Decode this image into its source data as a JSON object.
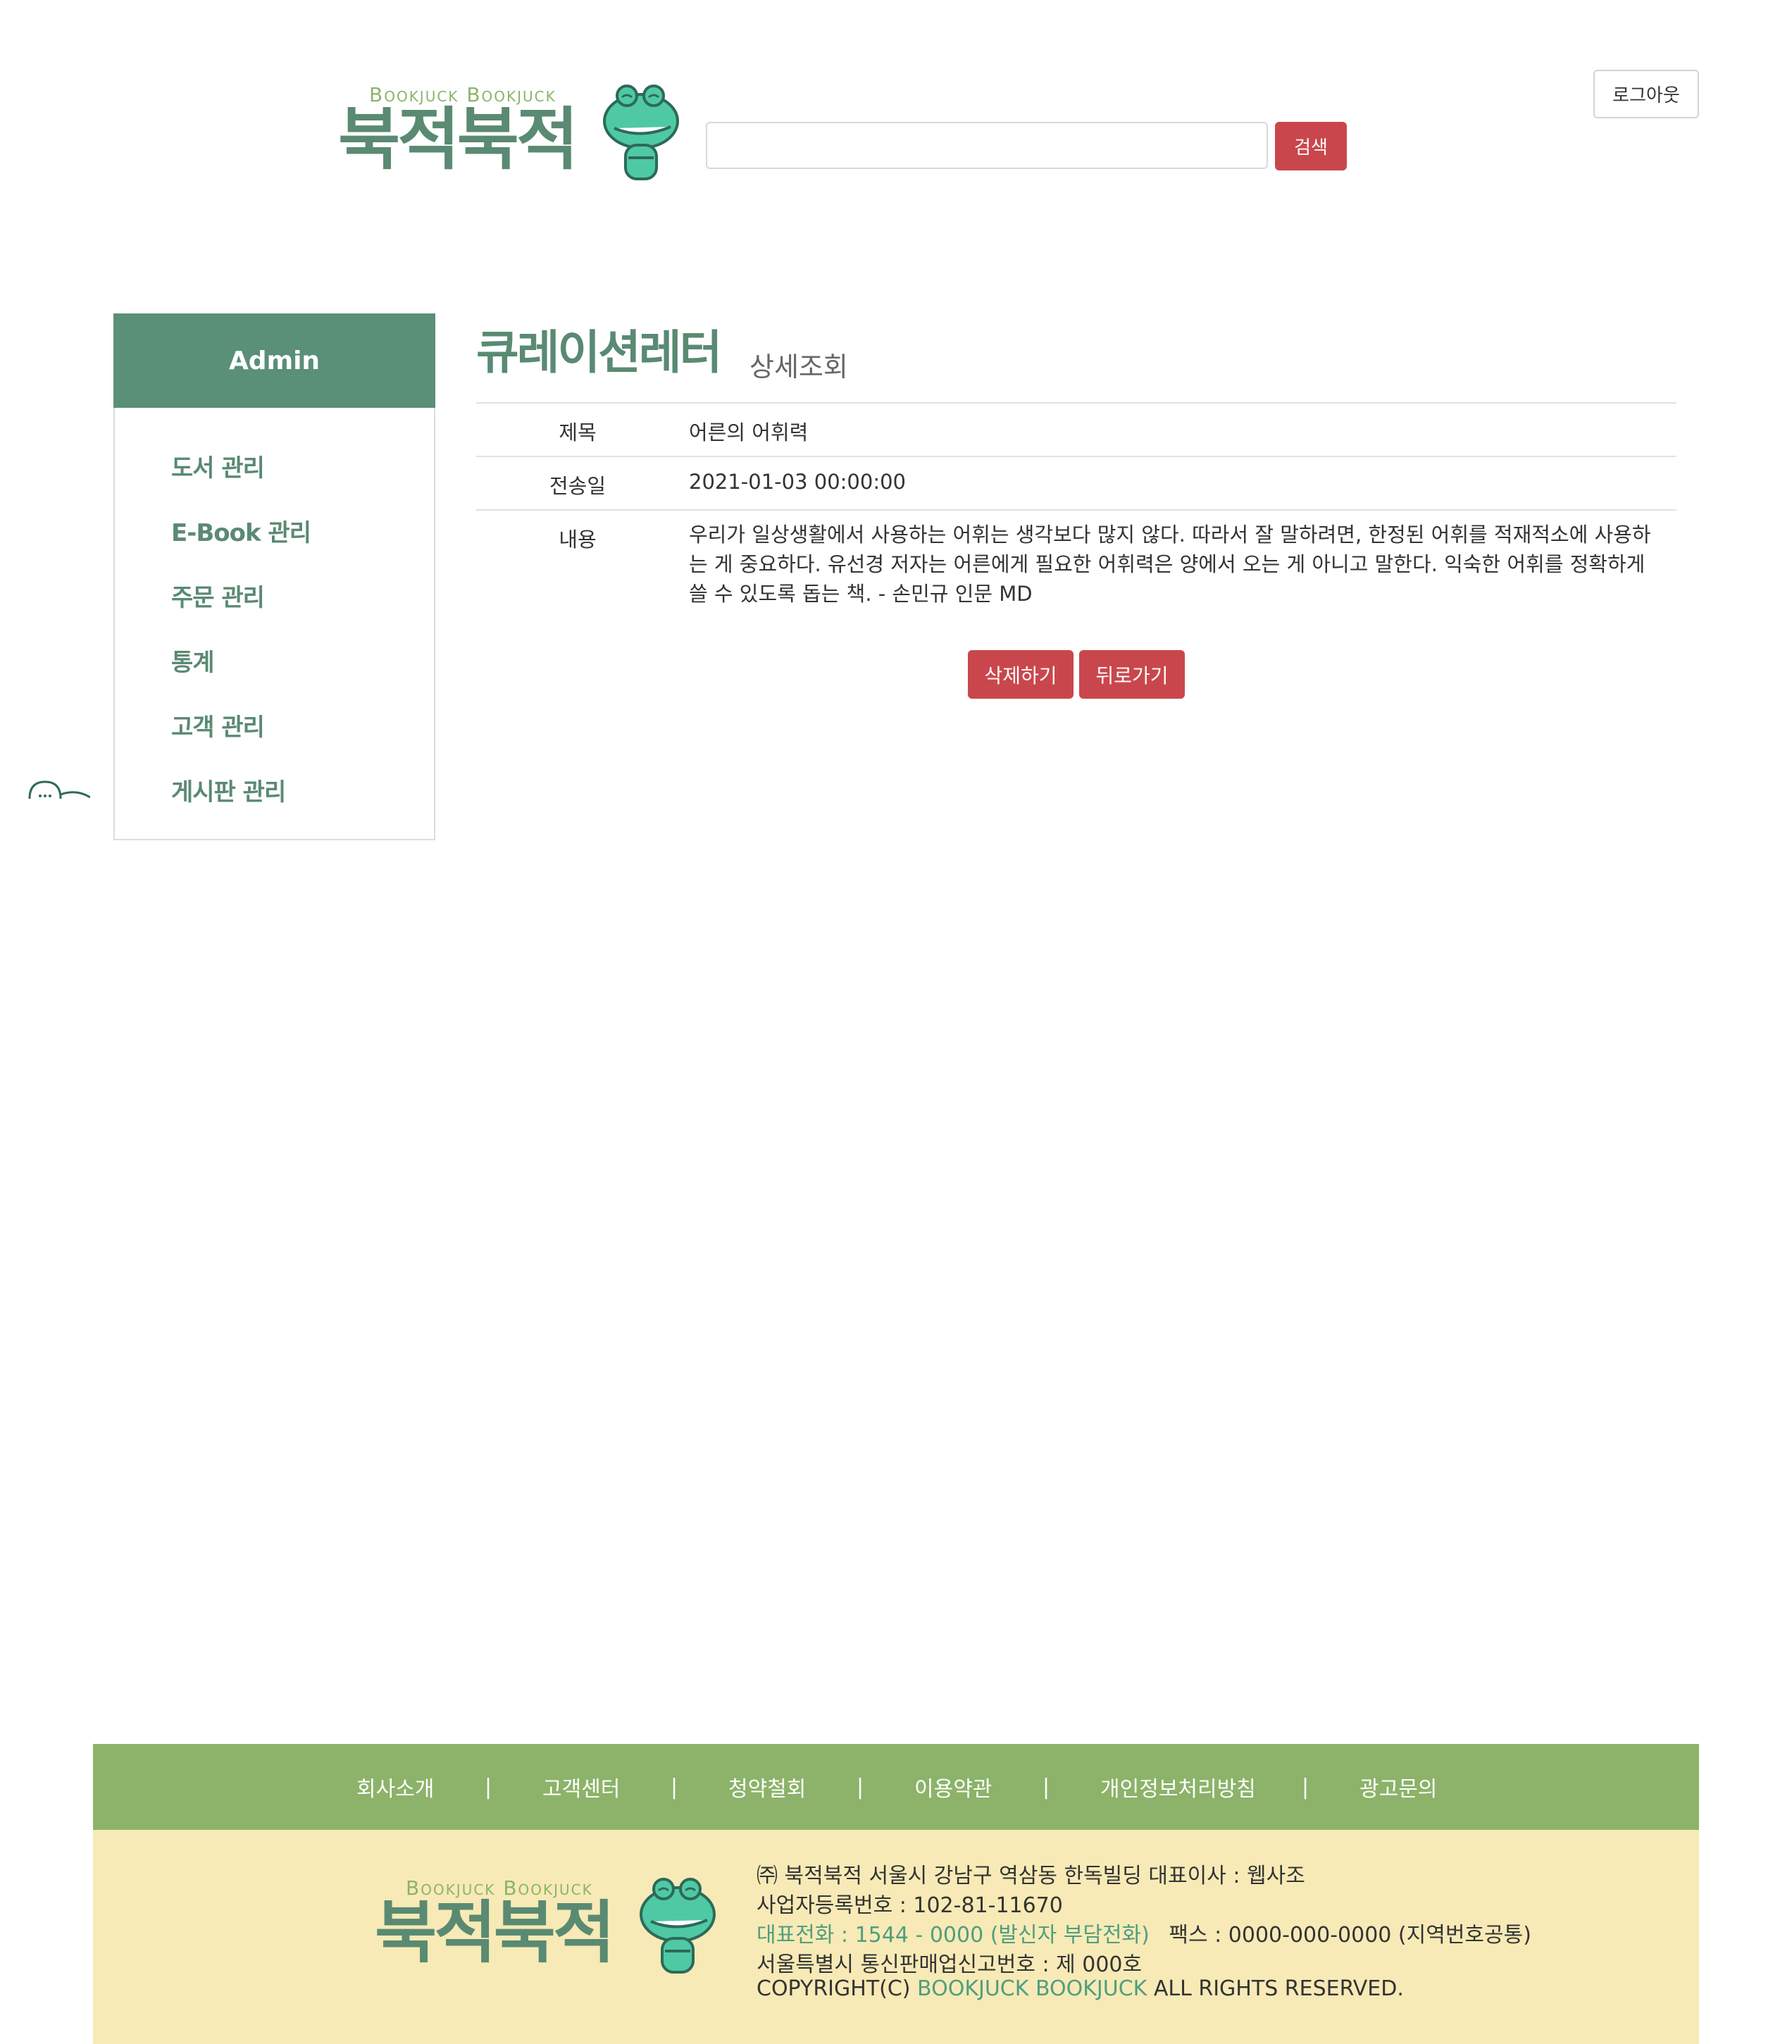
{
  "header": {
    "logo_sub": "Bookjuck Bookjuck",
    "logo_main": "북적북적",
    "search_placeholder": "",
    "search_button": "검색",
    "logout_button": "로그아웃"
  },
  "sidebar": {
    "title": "Admin",
    "items": [
      {
        "label": "도서 관리"
      },
      {
        "label": "E-Book 관리"
      },
      {
        "label": "주문 관리"
      },
      {
        "label": "통계"
      },
      {
        "label": "고객 관리"
      },
      {
        "label": "게시판 관리"
      }
    ]
  },
  "main": {
    "title": "큐레이션레터",
    "subtitle": "상세조회",
    "rows": [
      {
        "label": "제목",
        "value": "어른의 어휘력"
      },
      {
        "label": "전송일",
        "value": "2021-01-03 00:00:00"
      },
      {
        "label": "내용",
        "value": "우리가 일상생활에서 사용하는 어휘는 생각보다 많지 않다. 따라서 잘 말하려면, 한정된 어휘를 적재적소에 사용하 는 게 중요하다. 유선경 저자는 어른에게 필요한 어휘력은 양에서 오는 게 아니고 말한다. 익숙한 어휘를 정확하게 쓸 수 있도록 돕는 책. - 손민규 인문 MD"
      }
    ],
    "delete_button": "삭제하기",
    "back_button": "뒤로가기"
  },
  "footer": {
    "nav": [
      "회사소개",
      "고객센터",
      "청약철회",
      "이용약관",
      "개인정보처리방침",
      "광고문의"
    ],
    "separator": "|",
    "logo_sub": "Bookjuck Bookjuck",
    "logo_main": "북적북적",
    "line1": "㈜ 북적북적   서울시 강남구 역삼동 한독빌딩   대표이사 : 웹사조",
    "line2": "사업자등록번호 : 102-81-11670",
    "line3_phone": "대표전화 : 1544 - 0000 (발신자 부담전화)",
    "line3_fax": "팩스 : 0000-000-0000 (지역번호공통)",
    "line4": "서울특별시 통신판매업신고번호 : 제 000호",
    "line5_pre": "COPYRIGHT(C) ",
    "line5_brand": "BOOKJUCK BOOKJUCK",
    "line5_post": " ALL RIGHTS RESERVED."
  },
  "colors": {
    "brand_green": "#5a8a72",
    "sidebar_header": "#5a8f78",
    "button_red": "#c9474c",
    "footer_nav": "#8cb369",
    "footer_body": "#f7eab6"
  },
  "icons": [
    "crocodile-mascot-icon",
    "chat-bubble-icon"
  ]
}
